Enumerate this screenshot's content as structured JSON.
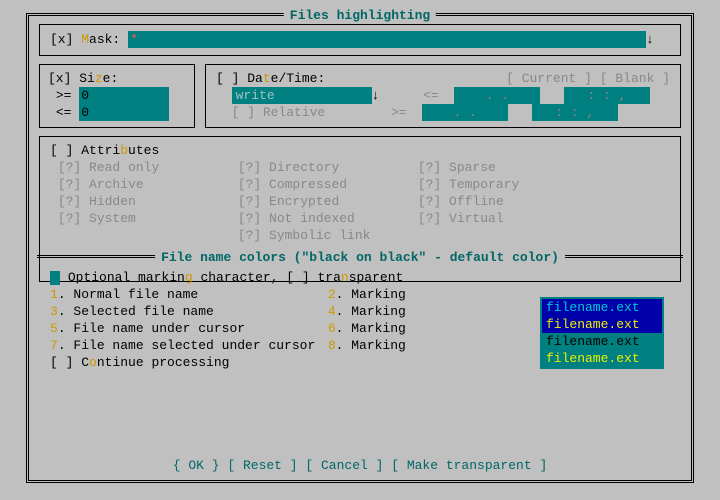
{
  "title": "Files highlighting",
  "mask": {
    "checkbox": "[x]",
    "label_pre": "M",
    "label_post": "ask:",
    "value": "*"
  },
  "size": {
    "checkbox": "[x]",
    "label_pre": "Si",
    "label_hk": "z",
    "label_post": "e:",
    "ge": ">=",
    "le": "<=",
    "v1": "0",
    "v2": "0"
  },
  "dt": {
    "checkbox": "[ ]",
    "label_pre": "Da",
    "label_hk": "t",
    "label_post": "e/Time:",
    "btn_current": "[ Current ]",
    "btn_blank": "[ Blank ]",
    "combo": "write",
    "relative_cb": "[ ]",
    "relative": "Relative",
    "le": "<=",
    "ge": ">=",
    "date_ph": ".  .     ",
    "time_ph": ":  :  ,"
  },
  "attr": {
    "checkbox": "[ ]",
    "label_pre": "Attri",
    "label_hk": "b",
    "label_post": "utes",
    "items": [
      "Read only",
      "Archive",
      "Hidden",
      "System",
      "Directory",
      "Compressed",
      "Encrypted",
      "Not indexed",
      "Symbolic link",
      "Sparse",
      "Temporary",
      "Offline",
      "Virtual"
    ]
  },
  "colors": {
    "title": "File name colors (\"black on black\" - default color)",
    "opt_pre": "Optional markin",
    "opt_hk": "g",
    "opt_post": " character, [ ] tra",
    "opt_hk2": "n",
    "opt_post2": "sparent",
    "rows": [
      {
        "n": "1",
        "label": ". Normal file name",
        "n2": "2",
        "m": ". Marking"
      },
      {
        "n": "3",
        "label": ". Selected file name",
        "n2": "4",
        "m": ". Marking"
      },
      {
        "n": "5",
        "label": ". File name under cursor",
        "n2": "6",
        "m": ". Marking"
      },
      {
        "n": "7",
        "label": ". File name selected under cursor",
        "n2": "8",
        "m": ". Marking"
      }
    ],
    "cont_cb": "[ ]",
    "cont_pre": "C",
    "cont_hk": "o",
    "cont_post": "ntinue processing"
  },
  "swatch": [
    {
      "text": "filename.ext",
      "bg": "#0000aa",
      "fg": "#00cccc"
    },
    {
      "text": "filename.ext",
      "bg": "#0000aa",
      "fg": "#eeee00"
    },
    {
      "text": "filename.ext",
      "bg": "#008080",
      "fg": "#000000"
    },
    {
      "text": "filename.ext",
      "bg": "#008080",
      "fg": "#eeee00"
    }
  ],
  "buttons": {
    "ok": "{ OK }",
    "reset": "[ Reset ]",
    "cancel": "[ Cancel ]",
    "make": "[ Make transparent ]"
  }
}
